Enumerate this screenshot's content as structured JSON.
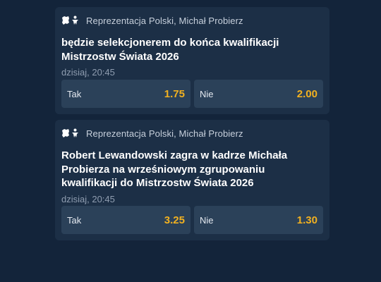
{
  "markets": [
    {
      "category": "Reprezentacja Polski, Michał Probierz",
      "icons": [
        "poland-map-icon",
        "football-player-icon"
      ],
      "title": "będzie selekcjonerem do końca kwalifikacji Mistrzostw Świata 2026",
      "time": "dzisiaj, 20:45",
      "options": [
        {
          "label": "Tak",
          "odds": "1.75"
        },
        {
          "label": "Nie",
          "odds": "2.00"
        }
      ]
    },
    {
      "category": "Reprezentacja Polski, Michał Probierz",
      "icons": [
        "poland-map-icon",
        "football-player-icon"
      ],
      "title": "Robert Lewandowski zagra w kadrze Michała Probierza na wrześniowym zgrupowaniu kwalifikacji do Mistrzostw Świata 2026",
      "time": "dzisiaj, 20:45",
      "options": [
        {
          "label": "Tak",
          "odds": "3.25"
        },
        {
          "label": "Nie",
          "odds": "1.30"
        }
      ]
    }
  ],
  "colors": {
    "background": "#13243a",
    "card": "#1c2f46",
    "button": "#2b4159",
    "odds": "#f2b120"
  }
}
